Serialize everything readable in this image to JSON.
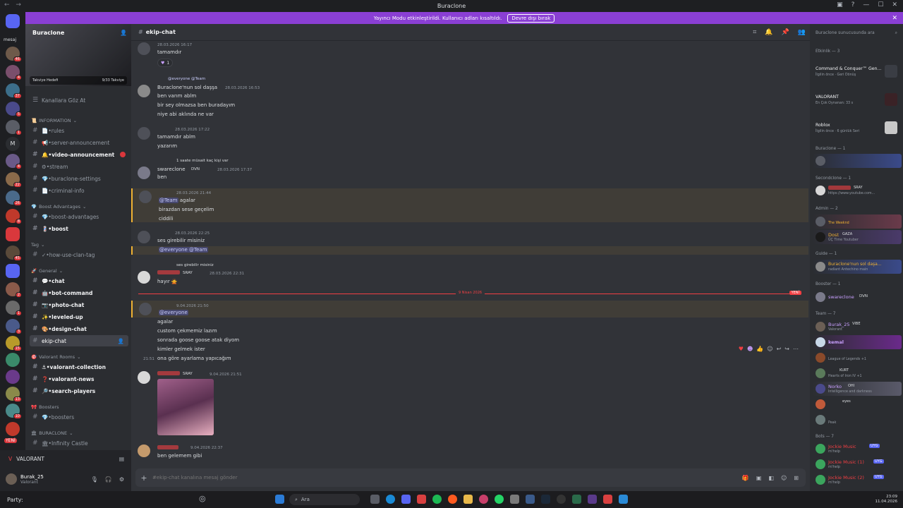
{
  "window": {
    "title": "Buraclone"
  },
  "banner": {
    "text": "Yayıncı Modu etkinleştirildi. Kullanıcı adları kısaltıldı.",
    "button": "Devre dışı bırak"
  },
  "servers": {
    "top_label": "mesaj",
    "label_m": "M",
    "new_label": "YENİ",
    "badges": [
      "46",
      "4",
      "37",
      "5",
      "1",
      "4",
      "22",
      "26",
      "8",
      "45",
      "2",
      "1",
      "3",
      "15",
      "13",
      "10"
    ]
  },
  "guild": {
    "name": "Buraclone",
    "boost_label": "Takviye Hedefi",
    "boost_value": "9/33 Takviye",
    "browse": "Kanallara Göz At"
  },
  "categories": {
    "info": "INFORMATION",
    "boost": "Boost Advantages",
    "tag": "Tag",
    "general": "General",
    "valorant": "Valorant Rooms",
    "boosters": "Boosters",
    "buraclone": "BURACLONE"
  },
  "channels": [
    {
      "label": "📄•rules"
    },
    {
      "label": "📢•server-announcement"
    },
    {
      "label": "🔔•video-announcement"
    },
    {
      "label": "⚙•stream"
    },
    {
      "label": "💎•buraclone-settings"
    },
    {
      "label": "📄•criminal-info"
    },
    {
      "label": "💎•boost-advantages"
    },
    {
      "label": "💈•boost"
    },
    {
      "label": "✓•how-use-clan-tag"
    },
    {
      "label": "💬•chat"
    },
    {
      "label": "🤖•bot-command"
    },
    {
      "label": "📷•photo-chat"
    },
    {
      "label": "✨•leveled-up"
    },
    {
      "label": "🎨•design-chat"
    },
    {
      "label": "ekip-chat"
    },
    {
      "label": "⚓•valorant-collection"
    },
    {
      "label": "❓•valorant-news"
    },
    {
      "label": "🔎•search-players"
    },
    {
      "label": "💎•boosters"
    },
    {
      "label": "🏛•Infinity Castle"
    }
  ],
  "voice": {
    "label": "VALORANT"
  },
  "user": {
    "name": "Burak_25",
    "status": "Valorant"
  },
  "channel": {
    "name": "ekip-chat",
    "placeholder": "#ekip-chat kanalına mesaj gönder"
  },
  "messages": [
    {
      "meta": "28.03.2026 16:17",
      "lines": [
        "tamamdır"
      ],
      "reaction_count": "1"
    },
    {
      "reply_mentions": "@everyone @Team",
      "author": "Buraclone'nun sol daşşa",
      "meta": "28.03.2026 16:53",
      "lines": [
        "ben varım ablm",
        "bir sey olmazsa ben buradayım",
        "niye abi aklında ne var"
      ]
    },
    {
      "meta": "28.03.2026 17:22",
      "lines": [
        "tamamdır ablm",
        "yazarım"
      ]
    },
    {
      "reply_text": "1 saate müsait kaç kişi var",
      "author": "swareclone",
      "tag": "DVN",
      "meta": "28.03.2026 17:37",
      "lines": [
        "ben"
      ]
    },
    {
      "meta": "28.03.2026 21:44",
      "mention": "@Team",
      "lines_after": "agalar",
      "lines": [
        "birazdan sese geçelim",
        "ciddili"
      ]
    },
    {
      "meta": "28.03.2026 22:25",
      "lines": [
        "ses girebilir misiniz"
      ],
      "mentions2": "@everyone @Team"
    },
    {
      "reply_text": "ses girebilir misiniz",
      "tag": "SRAY",
      "meta": "28.03.2026 22:31",
      "lines": [
        "hayır 🙅"
      ]
    },
    {
      "meta": "9.04.2026 21:50",
      "mention": "@everyone",
      "lines": [
        "agalar",
        "custom çekmemiz lazım",
        "sonrada goose goose atak diyom",
        "kimler gelmek ister",
        "ona göre ayarlama yapıcağım"
      ],
      "time_hover": "21:51"
    },
    {
      "tag": "SRAY",
      "meta": "9.04.2026 21:51",
      "lines": []
    },
    {
      "meta": "9.04.2026 22:37",
      "lines": [
        "ben gelemem gibi"
      ]
    }
  ],
  "divider": {
    "date": "9 Nisan 2026",
    "tag": "YENİ"
  },
  "members": {
    "search": "Buraclone sunucusunda ara",
    "activity_header": "Etkinlik — 3",
    "activities": [
      {
        "title": "Command & Conquer™ Gen...",
        "sub": "İlgilin önce · Geri Dönüş"
      },
      {
        "title": "VALORANT",
        "sub": "En Çok Oynanan: 33 s"
      },
      {
        "title": "Roblox",
        "sub": "İlgilin önce · 6 günlük Seri"
      }
    ],
    "groups": [
      {
        "label": "Buraclone — 1",
        "rows": [
          {
            "name": "",
            "sub": ""
          }
        ]
      },
      {
        "label": "Secondclone — 1",
        "rows": [
          {
            "name": "",
            "tag": "SRAY",
            "sub": "https://www.youtube.com..."
          }
        ]
      },
      {
        "label": "Admin — 2",
        "rows": [
          {
            "name": "",
            "sub": "The Weeknd"
          },
          {
            "name": "Dost",
            "tag": "GAZA",
            "sub": "ÜÇ Time Youtuber"
          }
        ]
      },
      {
        "label": "Guide — 1",
        "rows": [
          {
            "name": "Buraclone'nun sol daşa...",
            "sub": "radiant Antechino main"
          }
        ]
      },
      {
        "label": "Booster — 1",
        "rows": [
          {
            "name": "swareclone",
            "tag": "DVN",
            "sub": ""
          }
        ]
      },
      {
        "label": "Team — 7",
        "rows": [
          {
            "name": "Burak_25",
            "tag": "VIBE",
            "sub": "Valorant"
          },
          {
            "name": "kemal",
            "sub": ""
          },
          {
            "name": "",
            "sub": "League of Legends +1"
          },
          {
            "name": "",
            "tag": "KURT",
            "sub": "Hearts of Iron IV +1"
          },
          {
            "name": "Norko",
            "tag": "OHI",
            "sub": "Intelligence and darkness"
          },
          {
            "name": "",
            "tag": "eyes",
            "sub": ""
          },
          {
            "name": "",
            "sub": "Peak"
          }
        ]
      },
      {
        "label": "Bots — 7",
        "rows": [
          {
            "name": "Jockie Music",
            "tag": "UYG",
            "sub": "m!help"
          },
          {
            "name": "Jockie Music (1)",
            "tag": "UYG",
            "sub": "m!help"
          },
          {
            "name": "Jockie Music (2)",
            "tag": "UYG",
            "sub": "m!help"
          }
        ]
      }
    ]
  },
  "taskbar": {
    "party": "Party:",
    "search": "Ara",
    "time": "23:09",
    "date": "11.04.2026"
  },
  "colors": {
    "accent": "#8a3fd4",
    "mention": "#f0b232",
    "new": "#f23f43"
  }
}
